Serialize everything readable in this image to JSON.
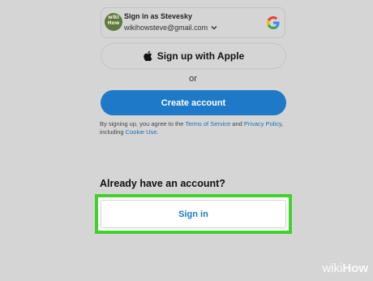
{
  "google_chip": {
    "avatar_text": "wiki How",
    "title": "Sign in as Stevesky",
    "email": "wikihowsteve@gmail.com",
    "icons": [
      "chevron-down-icon",
      "google-logo-icon"
    ]
  },
  "apple_button": {
    "label": "Sign up with Apple",
    "icon": "apple-icon"
  },
  "divider": {
    "or_text": "or"
  },
  "create_account": {
    "label": "Create account",
    "color": "#1e79c8"
  },
  "legal": {
    "prefix": "By signing up, you agree to the ",
    "terms_link": "Terms of Service",
    "and": " and ",
    "privacy_link": "Privacy Policy",
    "including": ", including ",
    "cookie_link": "Cookie Use",
    "suffix": "."
  },
  "signin_section": {
    "heading": "Already have an account?",
    "sign_in_label": "Sign in",
    "highlight_color": "#3fd22a"
  },
  "watermark": {
    "wiki": "wiki",
    "how": "How"
  }
}
